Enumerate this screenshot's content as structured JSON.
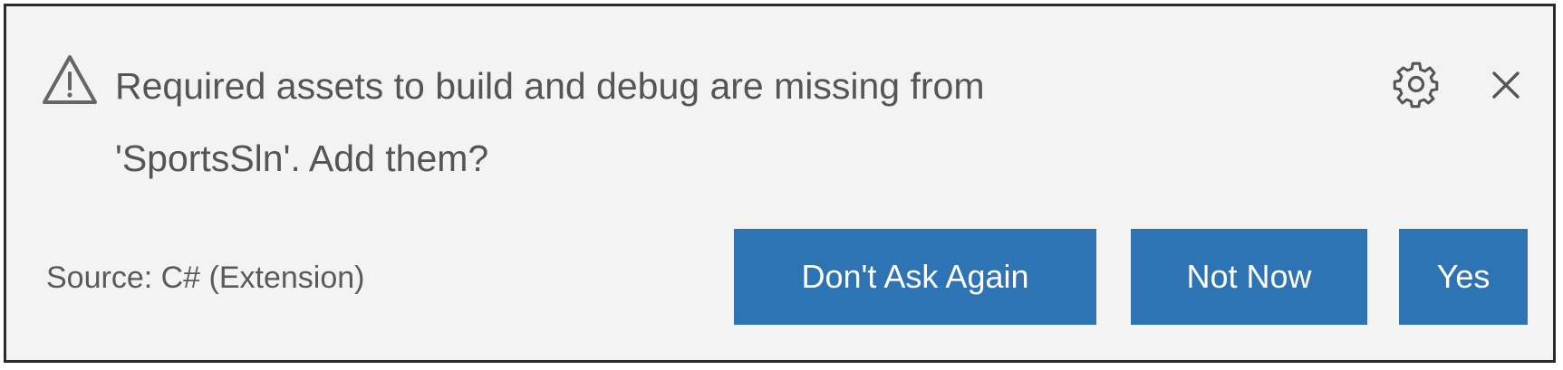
{
  "notification": {
    "message_line1": "Required assets to build and debug are missing from",
    "message_line2": "'SportsSln'. Add them?",
    "source": "Source: C# (Extension)",
    "icons": {
      "warning": "warning-triangle-icon",
      "settings": "gear-icon",
      "close": "close-icon"
    },
    "buttons": {
      "dont_ask_again": "Don't Ask Again",
      "not_now": "Not Now",
      "yes": "Yes"
    },
    "colors": {
      "background": "#f3f3f3",
      "border": "#2b2b2b",
      "text": "#555555",
      "button": "#2e74b5",
      "button_text": "#ffffff"
    }
  }
}
